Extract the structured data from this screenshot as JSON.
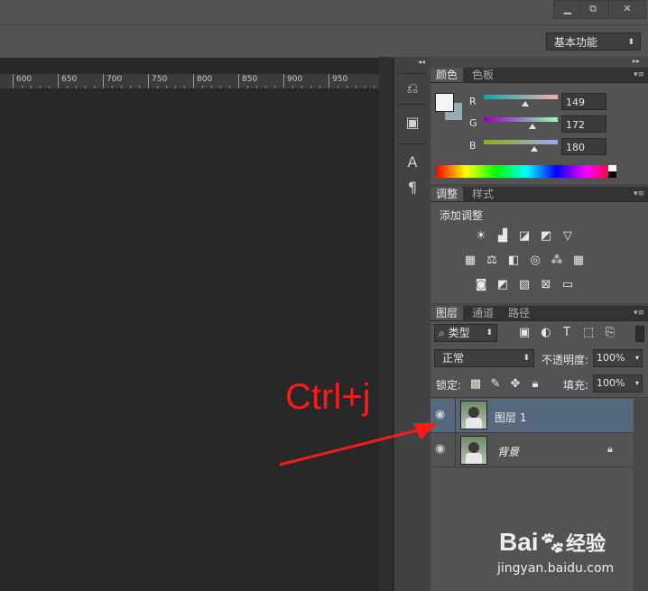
{
  "window": {
    "minimize": "▁",
    "restore": "⧉",
    "close": "✕"
  },
  "options_bar": {
    "workspace": "基本功能"
  },
  "ruler": {
    "ticks": [
      "600",
      "650",
      "700",
      "750",
      "800",
      "850",
      "900",
      "950"
    ]
  },
  "dock": {
    "icons": [
      "history-icon",
      "3d-icon",
      "character-icon",
      "paragraph-icon"
    ]
  },
  "color_panel": {
    "tabs": [
      "颜色",
      "色板"
    ],
    "channels": [
      {
        "label": "R",
        "value": "149"
      },
      {
        "label": "G",
        "value": "172"
      },
      {
        "label": "B",
        "value": "180"
      }
    ],
    "foreground": "#f4f4f4",
    "background_swatch": "#95acb4"
  },
  "adjust_panel": {
    "tabs": [
      "调整",
      "样式"
    ],
    "title": "添加调整"
  },
  "layers_panel": {
    "tabs": [
      "图层",
      "通道",
      "路径"
    ],
    "filter_kind": "类型",
    "blend_mode": "正常",
    "opacity_label": "不透明度:",
    "opacity_value": "100%",
    "lock_label": "锁定:",
    "fill_label": "填充:",
    "fill_value": "100%",
    "layers": [
      {
        "name": "图层 1",
        "selected": true
      },
      {
        "name": "背景",
        "selected": false,
        "locked": true
      }
    ]
  },
  "annotation": {
    "text": "Ctrl+j",
    "color": "#ff1a1a"
  },
  "watermark": {
    "brand": "Bai",
    "brand2": "经验",
    "url": "jingyan.baidu.com"
  }
}
